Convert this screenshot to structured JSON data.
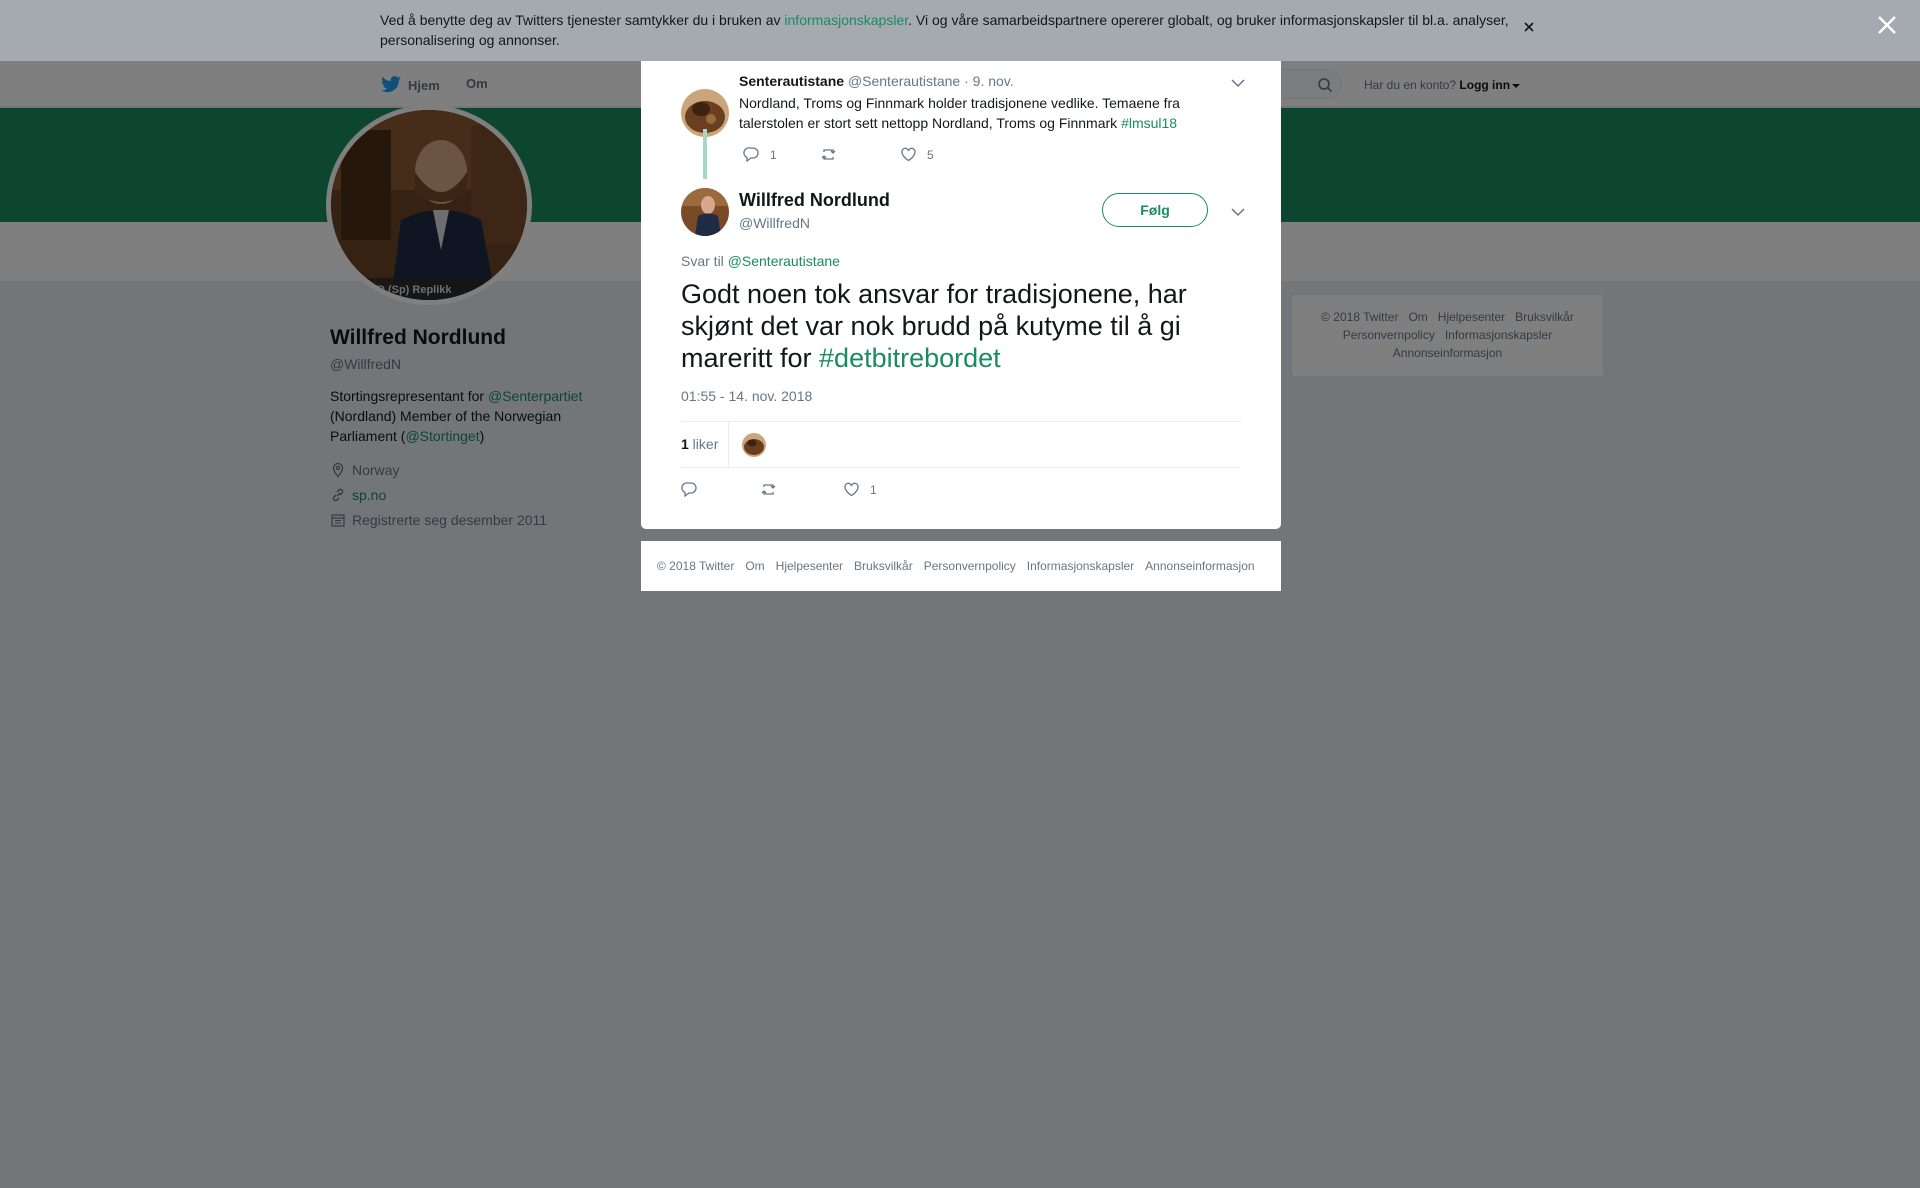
{
  "cookie": {
    "text_before": "Ved å benytte deg av Twitters tjenester samtykker du i bruken av ",
    "link": "informasjonskapsler",
    "text_after": ". Vi og våre samarbeidspartnere opererer globalt, og bruker informasjonskapsler til bl.a. analyser, personalisering og annonser."
  },
  "nav": {
    "home": "Hjem",
    "about": "Om",
    "login_prompt": "Har du en konto?",
    "login": "Logg inn"
  },
  "profile": {
    "name": "Willfred Nordlund",
    "handle": "@WillfredN",
    "bio_1": "Stortingsrepresentant for ",
    "bio_link_1": "@Senterpartiet",
    "bio_2": " (Nordland) Member of the Norwegian Parliament (",
    "bio_link_2": "@Stortinget",
    "bio_3": ")",
    "location": "Norway",
    "website": "sp.no",
    "joined": "Registrerte seg desember 2011",
    "photo_caption": "ND (Sp) Replikk"
  },
  "side_footer": [
    "© 2018 Twitter",
    "Om",
    "Hjelpesenter",
    "Bruksvilkår",
    "Personvernpolicy",
    "Informasjonskapsler",
    "Annonseinformasjon"
  ],
  "parent_tweet": {
    "name": "Senterautistane",
    "handle": "@Senterautistane",
    "date": "· 9. nov.",
    "text": "Nordland, Troms og Finnmark holder tradisjonene vedlike. Temaene fra talerstolen er stort sett nettopp Nordland, Troms og Finnmark ",
    "hashtag": "#lmsul18",
    "replies": "1",
    "retweets": "",
    "likes": "5"
  },
  "main_tweet": {
    "name": "Willfred Nordlund",
    "handle": "@WillfredN",
    "follow": "Følg",
    "reply_prefix": "Svar til ",
    "reply_to": "@Senterautistane",
    "text": "Godt noen tok ansvar for tradisjonene, har skjønt det var nok brudd på kutyme til å gi mareritt for ",
    "hashtag": "#detbitrebordet",
    "time": "01:55 - 14. nov. 2018",
    "like_count": "1",
    "like_label": " liker",
    "actions": {
      "replies": "",
      "retweets": "",
      "likes": "1"
    }
  },
  "modal_footer": [
    "© 2018 Twitter",
    "Om",
    "Hjelpesenter",
    "Bruksvilkår",
    "Personvernpolicy",
    "Informasjonskapsler",
    "Annonseinformasjon"
  ],
  "colors": {
    "accent": "#1b8c5f",
    "banner": "#1b8c5f",
    "thread_line": "#a8d8c5"
  }
}
